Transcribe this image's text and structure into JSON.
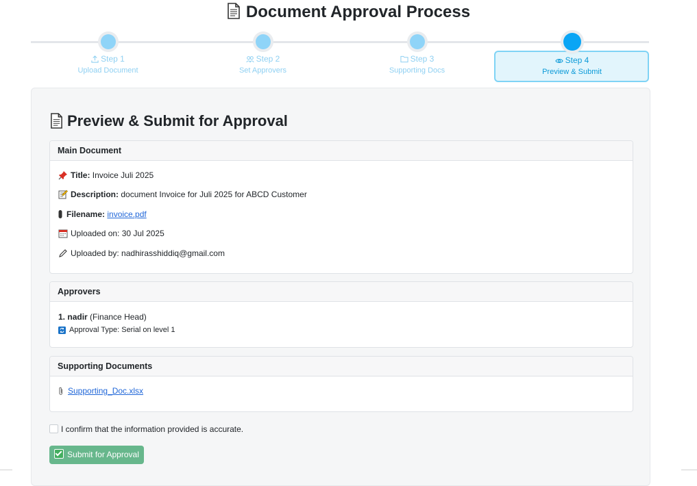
{
  "page": {
    "title": "Document Approval Process",
    "title_icon": "page-icon"
  },
  "steps": [
    {
      "num": "Step 1",
      "label": "Upload Document",
      "icon": "upload-icon"
    },
    {
      "num": "Step 2",
      "label": "Set Approvers",
      "icon": "users-icon"
    },
    {
      "num": "Step 3",
      "label": "Supporting Docs",
      "icon": "folder-icon"
    },
    {
      "num": "Step 4",
      "label": "Preview & Submit",
      "icon": "eye-icon",
      "active": true
    }
  ],
  "preview": {
    "title": "Preview & Submit for Approval",
    "main": {
      "header": "Main Document",
      "title_label": "Title:",
      "title_value": "Invoice Juli 2025",
      "desc_label": "Description:",
      "desc_value": "document Invoice for Juli 2025 for ABCD Customer",
      "file_label": "Filename:",
      "file_value": "invoice.pdf",
      "uploaded_on": "Uploaded on: 30 Jul 2025",
      "uploaded_by": "Uploaded by: nadhirasshiddiq@gmail.com"
    },
    "approvers": {
      "header": "Approvers",
      "items": [
        {
          "index": "1.",
          "name": "nadir",
          "role": "(Finance Head)",
          "type": "Approval Type: Serial on level 1"
        }
      ]
    },
    "supporting": {
      "header": "Supporting Documents",
      "files": [
        "Supporting_Doc.xlsx"
      ]
    },
    "confirm_text": "I confirm that the information provided is accurate.",
    "submit_label": "Submit for Approval"
  },
  "colors": {
    "accent": "#0aa5f5",
    "step_inactive": "#8fd4f8",
    "submit": "#5cb283",
    "link": "#1f66d8"
  }
}
